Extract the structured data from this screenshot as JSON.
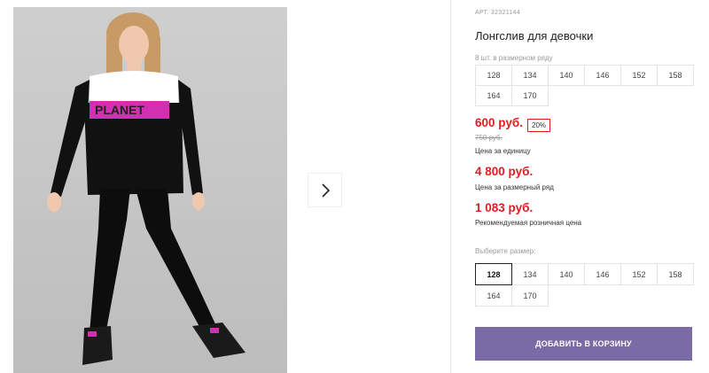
{
  "product": {
    "article_label": "АРТ.",
    "article": "32321144",
    "title": "Лонгслив для девочки",
    "size_row_note": "8 шт. в размерном ряду",
    "row_sizes": [
      "128",
      "134",
      "140",
      "146",
      "152",
      "158",
      "164",
      "170"
    ],
    "price": "600 руб.",
    "discount": "20%",
    "old_price": "750 руб.",
    "price_caption": "Цена за единицу",
    "row_price": "4 800 руб.",
    "row_price_caption": "Цена за размерный ряд",
    "retail_price": "1 083 руб.",
    "retail_price_caption": "Рекомендуемая розничная цена",
    "choose_size_label": "Выберите размер:",
    "sizes": [
      "128",
      "134",
      "140",
      "146",
      "152",
      "158",
      "164",
      "170"
    ],
    "selected_size": "128",
    "add_to_cart": "ДОБАВИТЬ В КОРЗИНУ"
  },
  "gallery": {
    "shirt_print": "PLANET",
    "next_icon": "chevron-right-icon"
  },
  "colors": {
    "accent_price": "#e31b23",
    "cart_button": "#7a6aa6"
  }
}
